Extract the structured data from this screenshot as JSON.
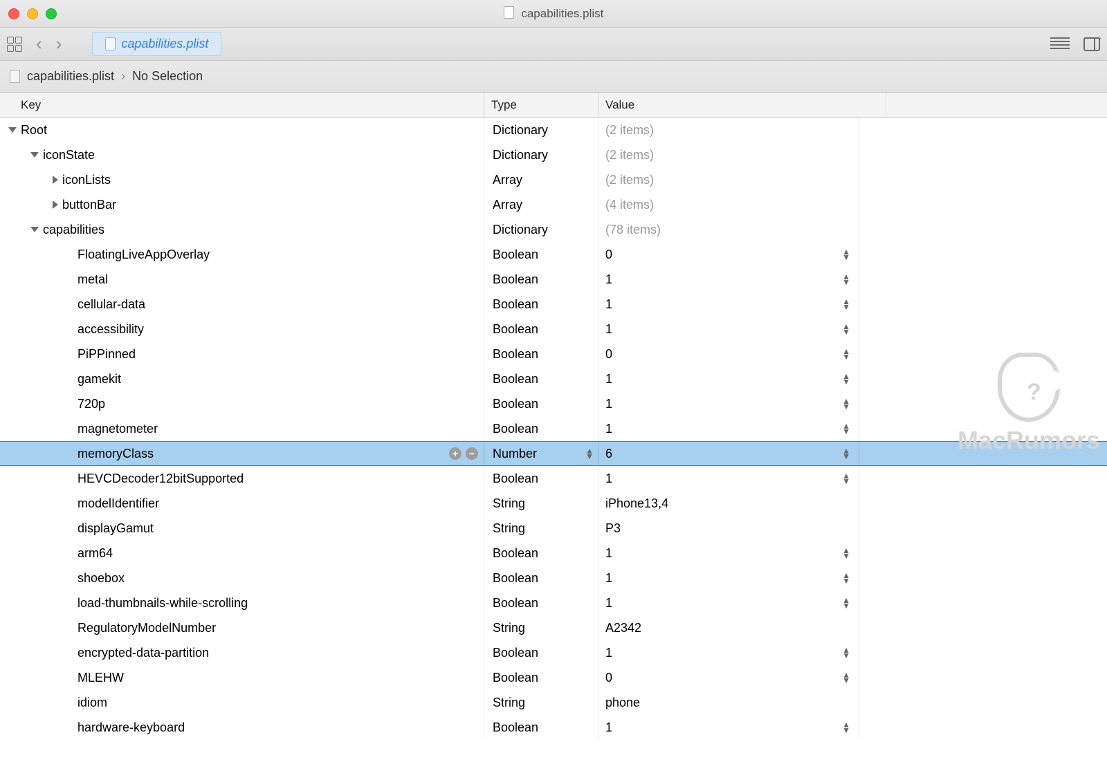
{
  "window": {
    "title": "capabilities.plist"
  },
  "tab": {
    "label": "capabilities.plist"
  },
  "breadcrumb": {
    "file": "capabilities.plist",
    "selection": "No Selection"
  },
  "columns": {
    "key": "Key",
    "type": "Type",
    "value": "Value"
  },
  "rows": [
    {
      "indent": 0,
      "tri": "down",
      "key": "Root",
      "type": "Dictionary",
      "value": "(2 items)",
      "dim": true,
      "stepper": false,
      "selected": false
    },
    {
      "indent": 1,
      "tri": "down",
      "key": "iconState",
      "type": "Dictionary",
      "value": "(2 items)",
      "dim": true,
      "stepper": false,
      "selected": false
    },
    {
      "indent": 2,
      "tri": "right",
      "key": "iconLists",
      "type": "Array",
      "value": "(2 items)",
      "dim": true,
      "stepper": false,
      "selected": false
    },
    {
      "indent": 2,
      "tri": "right",
      "key": "buttonBar",
      "type": "Array",
      "value": "(4 items)",
      "dim": true,
      "stepper": false,
      "selected": false
    },
    {
      "indent": 1,
      "tri": "down",
      "key": "capabilities",
      "type": "Dictionary",
      "value": "(78 items)",
      "dim": true,
      "stepper": false,
      "selected": false
    },
    {
      "indent": 2,
      "tri": "none",
      "key": "FloatingLiveAppOverlay",
      "type": "Boolean",
      "value": "0",
      "dim": false,
      "stepper": true,
      "selected": false
    },
    {
      "indent": 2,
      "tri": "none",
      "key": "metal",
      "type": "Boolean",
      "value": "1",
      "dim": false,
      "stepper": true,
      "selected": false
    },
    {
      "indent": 2,
      "tri": "none",
      "key": "cellular-data",
      "type": "Boolean",
      "value": "1",
      "dim": false,
      "stepper": true,
      "selected": false
    },
    {
      "indent": 2,
      "tri": "none",
      "key": "accessibility",
      "type": "Boolean",
      "value": "1",
      "dim": false,
      "stepper": true,
      "selected": false
    },
    {
      "indent": 2,
      "tri": "none",
      "key": "PiPPinned",
      "type": "Boolean",
      "value": "0",
      "dim": false,
      "stepper": true,
      "selected": false
    },
    {
      "indent": 2,
      "tri": "none",
      "key": "gamekit",
      "type": "Boolean",
      "value": "1",
      "dim": false,
      "stepper": true,
      "selected": false
    },
    {
      "indent": 2,
      "tri": "none",
      "key": "720p",
      "type": "Boolean",
      "value": "1",
      "dim": false,
      "stepper": true,
      "selected": false
    },
    {
      "indent": 2,
      "tri": "none",
      "key": "magnetometer",
      "type": "Boolean",
      "value": "1",
      "dim": false,
      "stepper": true,
      "selected": false
    },
    {
      "indent": 2,
      "tri": "none",
      "key": "memoryClass",
      "type": "Number",
      "value": "6",
      "dim": false,
      "stepper": true,
      "selected": true,
      "typeStepper": true,
      "addRemove": true
    },
    {
      "indent": 2,
      "tri": "none",
      "key": "HEVCDecoder12bitSupported",
      "type": "Boolean",
      "value": "1",
      "dim": false,
      "stepper": true,
      "selected": false
    },
    {
      "indent": 2,
      "tri": "none",
      "key": "modelIdentifier",
      "type": "String",
      "value": "iPhone13,4",
      "dim": false,
      "stepper": false,
      "selected": false
    },
    {
      "indent": 2,
      "tri": "none",
      "key": "displayGamut",
      "type": "String",
      "value": "P3",
      "dim": false,
      "stepper": false,
      "selected": false
    },
    {
      "indent": 2,
      "tri": "none",
      "key": "arm64",
      "type": "Boolean",
      "value": "1",
      "dim": false,
      "stepper": true,
      "selected": false
    },
    {
      "indent": 2,
      "tri": "none",
      "key": "shoebox",
      "type": "Boolean",
      "value": "1",
      "dim": false,
      "stepper": true,
      "selected": false
    },
    {
      "indent": 2,
      "tri": "none",
      "key": "load-thumbnails-while-scrolling",
      "type": "Boolean",
      "value": "1",
      "dim": false,
      "stepper": true,
      "selected": false
    },
    {
      "indent": 2,
      "tri": "none",
      "key": "RegulatoryModelNumber",
      "type": "String",
      "value": "A2342",
      "dim": false,
      "stepper": false,
      "selected": false
    },
    {
      "indent": 2,
      "tri": "none",
      "key": "encrypted-data-partition",
      "type": "Boolean",
      "value": "1",
      "dim": false,
      "stepper": true,
      "selected": false
    },
    {
      "indent": 2,
      "tri": "none",
      "key": "MLEHW",
      "type": "Boolean",
      "value": "0",
      "dim": false,
      "stepper": true,
      "selected": false
    },
    {
      "indent": 2,
      "tri": "none",
      "key": "idiom",
      "type": "String",
      "value": "phone",
      "dim": false,
      "stepper": false,
      "selected": false
    },
    {
      "indent": 2,
      "tri": "none",
      "key": "hardware-keyboard",
      "type": "Boolean",
      "value": "1",
      "dim": false,
      "stepper": true,
      "selected": false
    }
  ],
  "watermark": "MacRumors"
}
